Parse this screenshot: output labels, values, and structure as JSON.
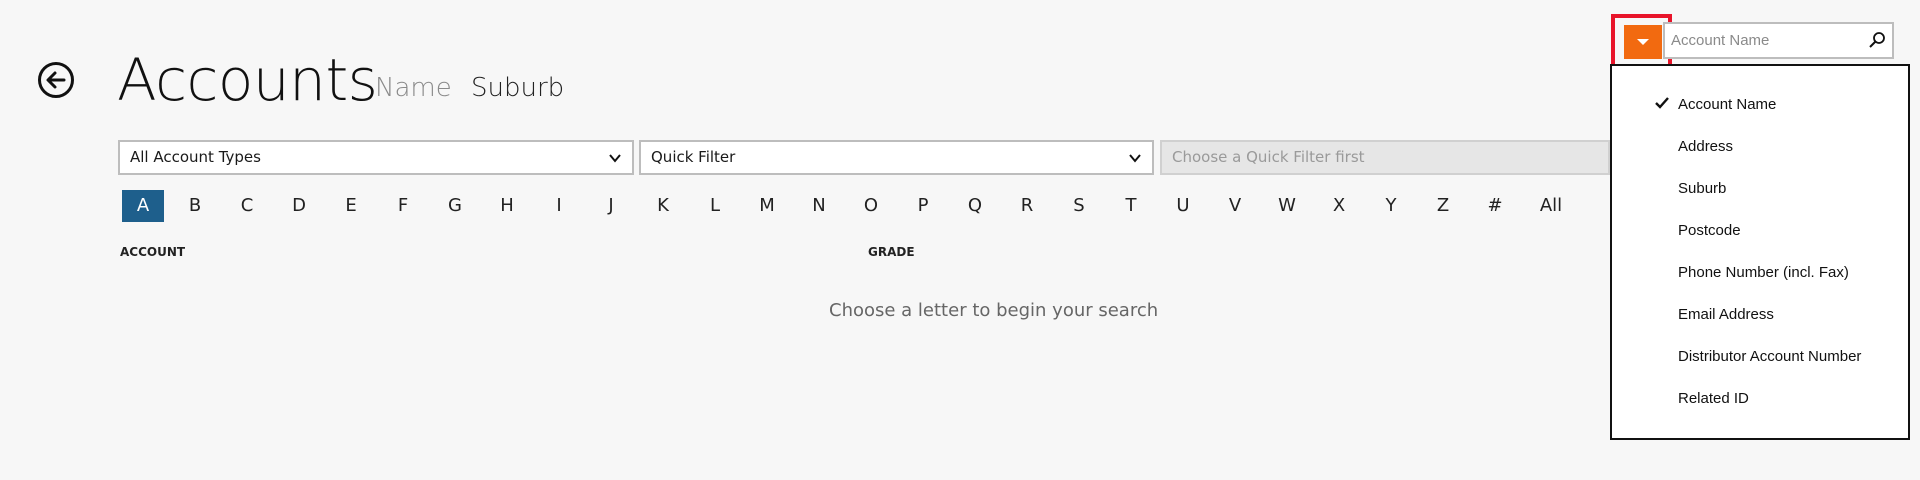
{
  "header": {
    "title": "Accounts",
    "sort_options": [
      {
        "label": "Name",
        "selected": false
      },
      {
        "label": "Suburb",
        "selected": true
      }
    ]
  },
  "filters": {
    "account_types": {
      "value": "All Account Types",
      "icon": "chevron-down-icon"
    },
    "quick_filter": {
      "value": "Quick Filter",
      "icon": "chevron-down-icon"
    },
    "quick_filter_value": {
      "placeholder": "Choose a Quick Filter first",
      "disabled": true
    }
  },
  "letters": {
    "items": [
      "A",
      "B",
      "C",
      "D",
      "E",
      "F",
      "G",
      "H",
      "I",
      "J",
      "K",
      "L",
      "M",
      "N",
      "O",
      "P",
      "Q",
      "R",
      "S",
      "T",
      "U",
      "V",
      "W",
      "X",
      "Y",
      "Z",
      "#",
      "All"
    ],
    "active": "A",
    "active_color": "#1e5f8c"
  },
  "columns": {
    "account": "ACCOUNT",
    "grade": "GRADE"
  },
  "empty_message": "Choose a letter to begin your search",
  "search": {
    "placeholder": "Account Name",
    "icon": "search-icon",
    "dropdown_color": "#f26a10",
    "highlight_color": "#e8142a"
  },
  "search_field_menu": {
    "selected": "Account Name",
    "items": [
      {
        "label": "Account Name",
        "checked": true
      },
      {
        "label": "Address",
        "checked": false
      },
      {
        "label": "Suburb",
        "checked": false
      },
      {
        "label": "Postcode",
        "checked": false
      },
      {
        "label": "Phone Number (incl. Fax)",
        "checked": false
      },
      {
        "label": "Email Address",
        "checked": false
      },
      {
        "label": "Distributor Account Number",
        "checked": false
      },
      {
        "label": "Related ID",
        "checked": false
      }
    ]
  }
}
